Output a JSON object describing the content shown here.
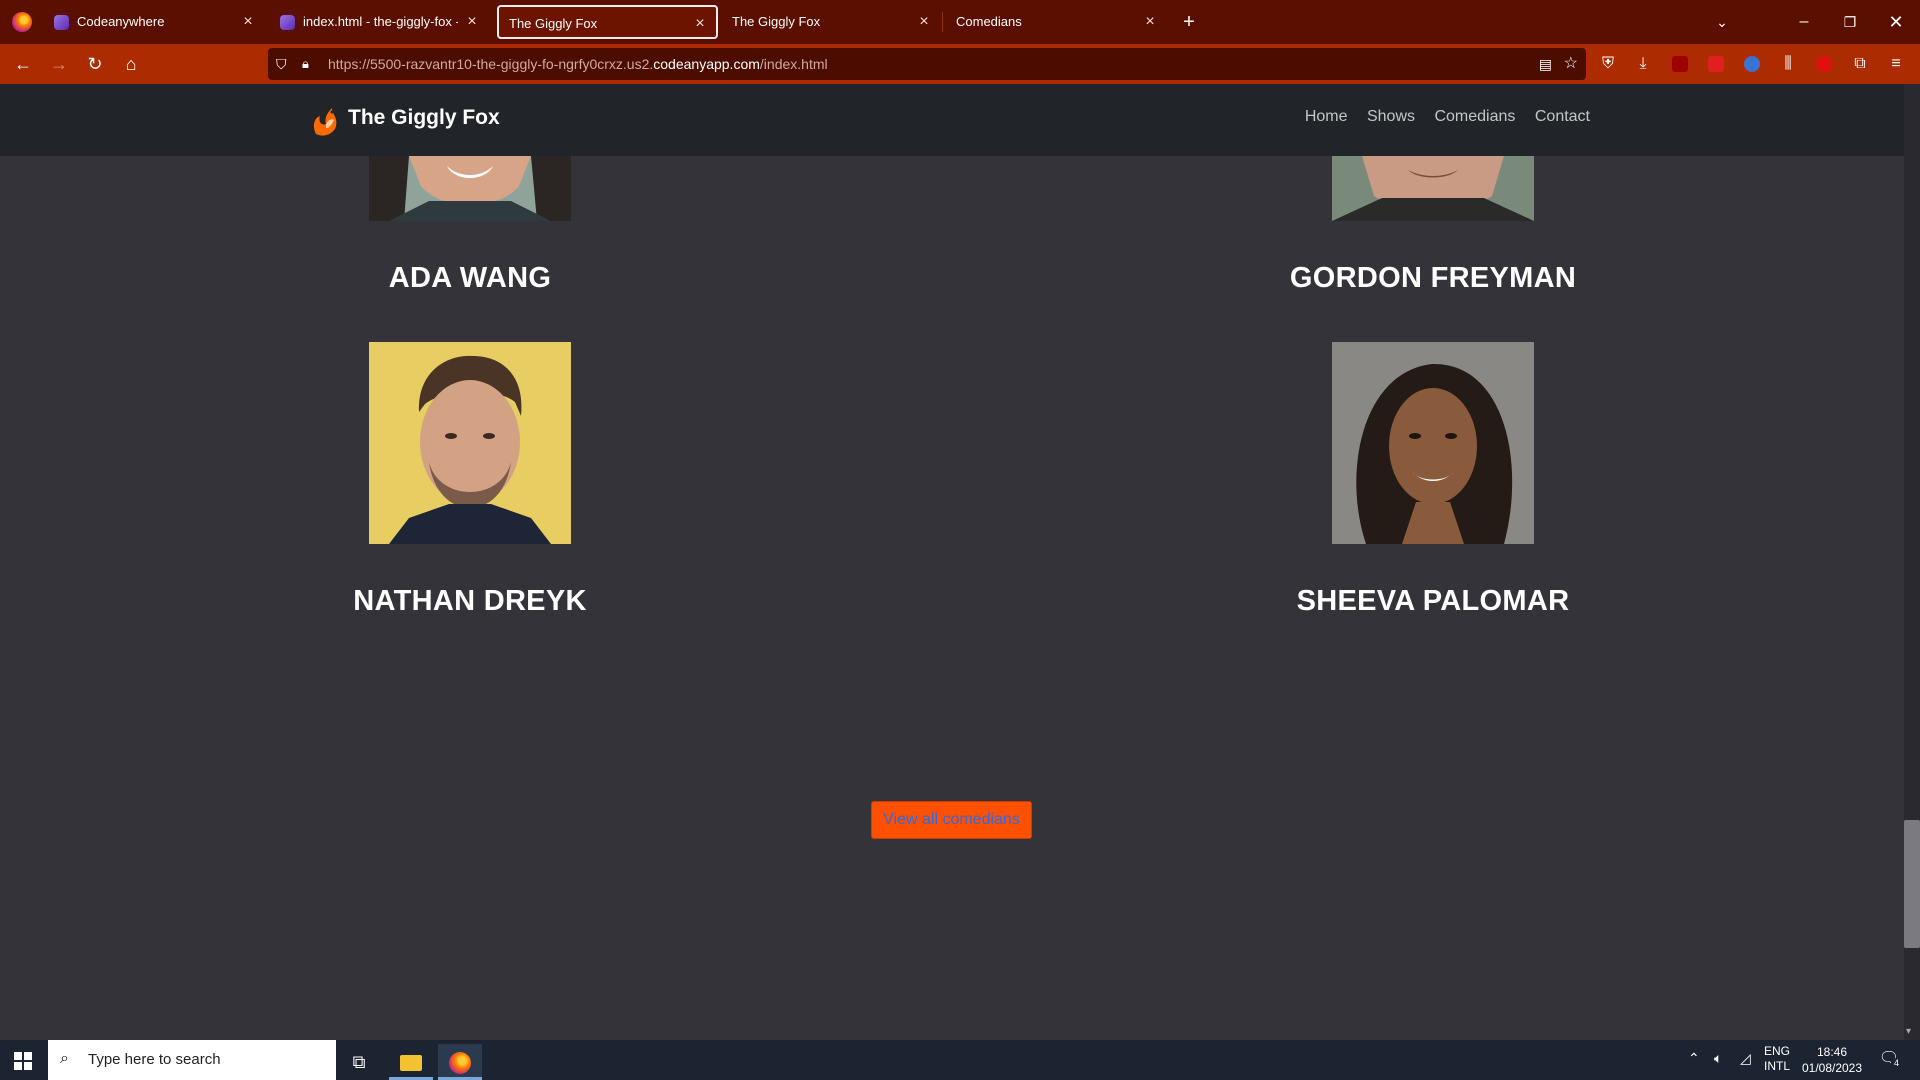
{
  "browser": {
    "tabs": [
      {
        "title": "Codeanywhere",
        "favicon": "codeanywhere-icon",
        "active": false
      },
      {
        "title": "index.html - the-giggly-fox - C",
        "favicon": "codeanywhere-icon",
        "active": false
      },
      {
        "title": "The Giggly Fox",
        "favicon": "",
        "active": true
      },
      {
        "title": "The Giggly Fox",
        "favicon": "",
        "active": false
      },
      {
        "title": "Comedians",
        "favicon": "",
        "active": false
      }
    ],
    "new_tab_symbol": "+",
    "url_prefix": "https://5500-razvantr10-the-giggly-fo-ngrfy0crxz.us2.",
    "url_domain": "codeanyapp.com",
    "url_suffix": "/index.html",
    "theme_color": "#ac2b00"
  },
  "site": {
    "brand": "The Giggly Fox",
    "nav": [
      "Home",
      "Shows",
      "Comedians",
      "Contact"
    ],
    "comedians": [
      {
        "name": "ADA WANG"
      },
      {
        "name": "GORDON FREYMAN"
      },
      {
        "name": "NATHAN DREYK"
      },
      {
        "name": "SHEEVA PALOMAR"
      }
    ],
    "cta_label": "View all comedians",
    "accent": "#ff5000",
    "background": "#34333a"
  },
  "taskbar": {
    "search_placeholder": "Type here to search",
    "lang_top": "ENG",
    "lang_bottom": "INTL",
    "time": "18:46",
    "date": "01/08/2023",
    "notification_count": "4"
  }
}
